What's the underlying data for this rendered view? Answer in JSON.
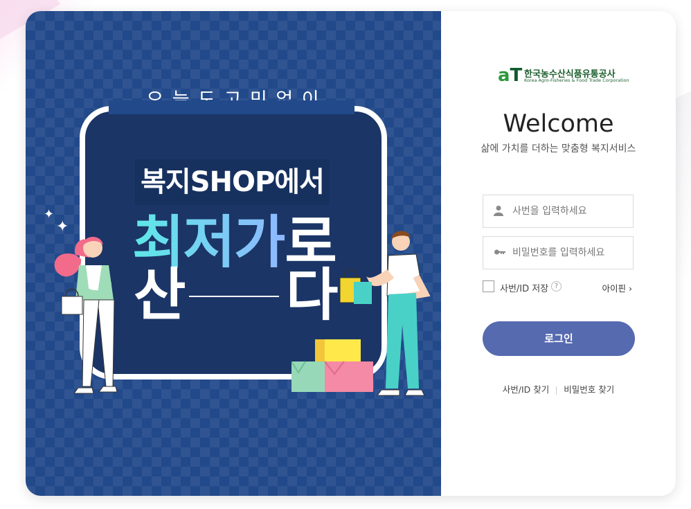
{
  "banner": {
    "tagline": "오.늘.도.고.민.없.이",
    "shop_title": "복지SHOP에서",
    "headline_accent": "최저가",
    "headline_rest": "로",
    "headline_line2_left": "산",
    "headline_line2_right": "다"
  },
  "logo": {
    "mark_a": "a",
    "mark_t": "T",
    "name_ko": "한국농수산식품유통공사",
    "name_en": "Korea Agro-Fisheries & Food Trade Corporation"
  },
  "login": {
    "welcome": "Welcome",
    "subtitle": "삶에 가치를 더하는 맞춤형 복지서비스",
    "id_placeholder": "사번을 입력하세요",
    "password_placeholder": "비밀번호를 입력하세요",
    "save_id_label": "사번/ID 저장",
    "help_symbol": "?",
    "ipin_label": "아이핀 ›",
    "login_button": "로그인",
    "find_id_link": "사번/ID 찾기",
    "find_password_link": "비밀번호 찾기"
  },
  "colors": {
    "banner_bg": "#22498a",
    "button": "#566aaf",
    "logo_green": "#2d9a3b"
  }
}
